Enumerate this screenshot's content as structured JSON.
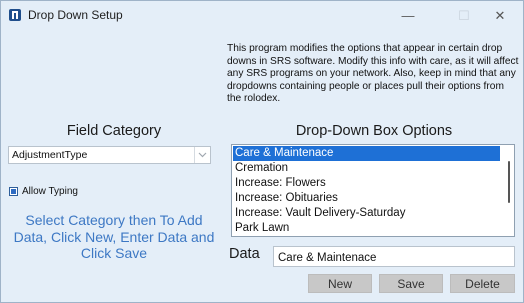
{
  "window": {
    "title": "Drop Down Setup",
    "minimize_glyph": "—",
    "maximize_glyph": "☐",
    "close_glyph": "✕"
  },
  "info_text": "This program modifies the options that appear in certain drop downs in SRS software.  Modify this info with care, as it will affect any SRS programs on your network.  Also, keep in mind that any dropdowns containing people or places pull their options from the rolodex.",
  "field_category": {
    "heading": "Field Category",
    "selected": "AdjustmentType"
  },
  "allow_typing": {
    "label": "Allow Typing",
    "checked": true
  },
  "instructions": "Select Category then To Add Data, Click New, Enter Data and Click Save",
  "options": {
    "heading": "Drop-Down Box Options",
    "items": [
      "Care & Maintenace",
      "Cremation",
      "Increase: Flowers",
      "Increase: Obituaries",
      "Increase: Vault Delivery-Saturday",
      "Park Lawn"
    ],
    "selected_index": 0
  },
  "data_field": {
    "label": "Data",
    "value": "Care & Maintenace"
  },
  "buttons": {
    "new": "New",
    "save": "Save",
    "delete": "Delete"
  },
  "colors": {
    "background": "#e4eef8",
    "selection": "#1e70d6",
    "instruction_text": "#3d78c4",
    "button": "#c8c8c8"
  }
}
